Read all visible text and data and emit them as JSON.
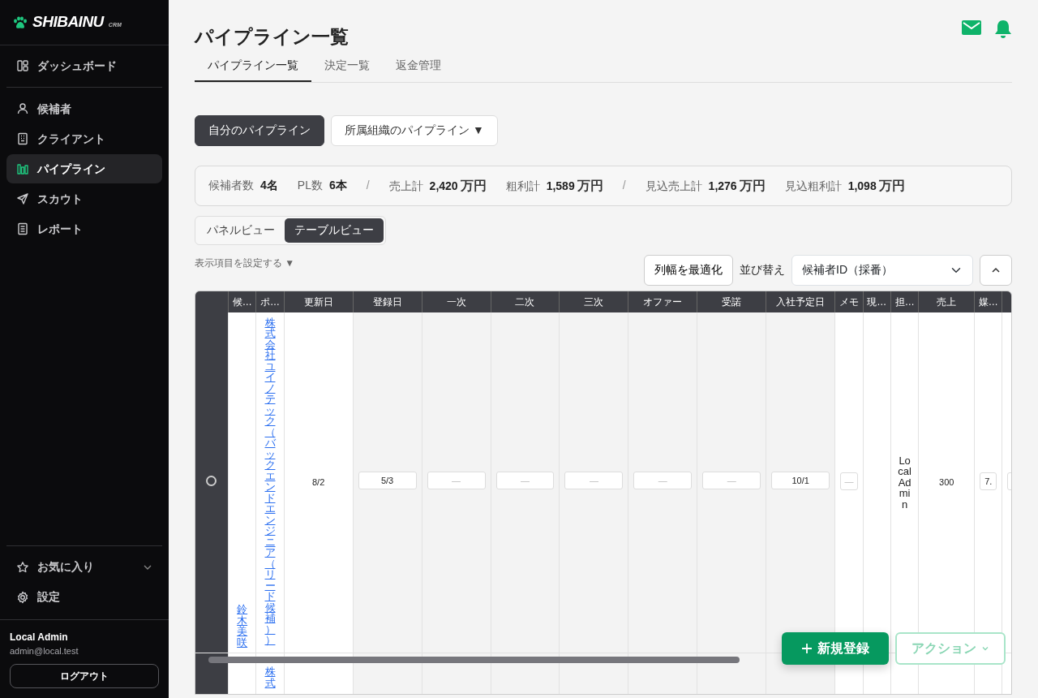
{
  "brand": {
    "name": "SHIBAINU",
    "sub": "CRM"
  },
  "nav_groups": [
    [
      {
        "label": "ダッシュボード",
        "selected": false
      }
    ],
    [
      {
        "label": "候補者",
        "selected": false
      },
      {
        "label": "クライアント",
        "selected": false
      },
      {
        "label": "パイプライン",
        "selected": true
      },
      {
        "label": "スカウト",
        "selected": false
      },
      {
        "label": "レポート",
        "selected": false
      }
    ]
  ],
  "footer_nav": [
    {
      "label": "お気に入り",
      "expanded": false
    },
    {
      "label": "設定"
    }
  ],
  "user": {
    "name": "Local Admin",
    "email": "admin@local.test",
    "logout": "ログアウト"
  },
  "page": {
    "title": "パイプライン一覧"
  },
  "tabs": [
    {
      "label": "パイプライン一覧",
      "selected": true
    },
    {
      "label": "決定一覧",
      "selected": false
    },
    {
      "label": "返金管理",
      "selected": false
    }
  ],
  "scope_buttons": [
    {
      "label": "自分のパイプライン",
      "selected": true
    },
    {
      "label": "所属組織のパイプライン ▼",
      "selected": false
    }
  ],
  "summary": [
    {
      "kind": "count",
      "label": "候補者数",
      "value": "4名"
    },
    {
      "kind": "count",
      "label": "PL数",
      "value": "6本"
    },
    {
      "kind": "divider",
      "value": "/"
    },
    {
      "kind": "money",
      "label": "売上計",
      "value": "2,420",
      "unit": "万円"
    },
    {
      "kind": "money",
      "label": "粗利計",
      "value": "1,589",
      "unit": "万円"
    },
    {
      "kind": "divider",
      "value": "/"
    },
    {
      "kind": "money",
      "label": "見込売上計",
      "value": "1,276",
      "unit": "万円"
    },
    {
      "kind": "money",
      "label": "見込粗利計",
      "value": "1,098",
      "unit": "万円"
    }
  ],
  "views": [
    {
      "label": "パネルビュー",
      "selected": false
    },
    {
      "label": "テーブルビュー",
      "selected": true
    }
  ],
  "column_settings": "表示項目を設定する ▼",
  "fit_button": "列幅を最適化",
  "sort": {
    "label": "並び替え",
    "value": "候補者ID（採番）"
  },
  "table": {
    "columns": [
      {
        "kind": "select",
        "shaded": false
      },
      {
        "label": "候…",
        "kind": "narrow",
        "shaded": false
      },
      {
        "label": "ポ…",
        "kind": "narrow",
        "shaded": false
      },
      {
        "label": "更新日",
        "kind": "wide",
        "shaded": false
      },
      {
        "label": "登録日",
        "kind": "wide",
        "shaded": true
      },
      {
        "label": "一次",
        "kind": "wide",
        "shaded": true
      },
      {
        "label": "二次",
        "kind": "wide",
        "shaded": true
      },
      {
        "label": "三次",
        "kind": "wide",
        "shaded": true
      },
      {
        "label": "オファー",
        "kind": "wide",
        "shaded": true
      },
      {
        "label": "受諾",
        "kind": "wide",
        "shaded": true
      },
      {
        "label": "入社予定日",
        "kind": "wide",
        "shaded": true
      },
      {
        "label": "メモ",
        "kind": "narrow",
        "shaded": false
      },
      {
        "label": "現…",
        "kind": "narrow",
        "shaded": false
      },
      {
        "label": "担…",
        "kind": "narrow",
        "shaded": false
      },
      {
        "label": "売上",
        "kind": "medium",
        "shaded": false
      },
      {
        "label": "媒…",
        "kind": "narrow",
        "shaded": false
      },
      {
        "kind": "narrow",
        "shaded": false
      }
    ],
    "rows": [
      {
        "cells": [
          {
            "kind": "select",
            "selected": false
          },
          {
            "kind": "name",
            "value": "鈴木美咲"
          },
          {
            "kind": "link",
            "value": "株式会社ユイノテック（バックエンドエンジニア（リード候補））"
          },
          {
            "kind": "text",
            "value": "8/2"
          },
          {
            "kind": "box",
            "value": "5/3"
          },
          {
            "kind": "box",
            "placeholder": "—"
          },
          {
            "kind": "box",
            "placeholder": "—"
          },
          {
            "kind": "box",
            "placeholder": "—"
          },
          {
            "kind": "box",
            "placeholder": "—"
          },
          {
            "kind": "box",
            "placeholder": "—"
          },
          {
            "kind": "box",
            "value": "10/1"
          },
          {
            "kind": "box",
            "placeholder": "—"
          },
          {
            "kind": "empty"
          },
          {
            "kind": "text",
            "value": "Local Admin"
          },
          {
            "kind": "text",
            "value": "300"
          },
          {
            "kind": "box",
            "value": "7."
          },
          {
            "kind": "box"
          }
        ]
      },
      {
        "cells": [
          {
            "kind": "select"
          },
          {
            "kind": "empty"
          },
          {
            "kind": "link",
            "value": "株式"
          },
          {
            "kind": "empty"
          },
          {
            "kind": "empty"
          },
          {
            "kind": "empty"
          },
          {
            "kind": "empty"
          },
          {
            "kind": "empty"
          },
          {
            "kind": "empty"
          },
          {
            "kind": "empty"
          },
          {
            "kind": "empty"
          },
          {
            "kind": "empty"
          },
          {
            "kind": "empty"
          },
          {
            "kind": "empty"
          },
          {
            "kind": "empty"
          },
          {
            "kind": "empty"
          },
          {
            "kind": "empty"
          }
        ]
      }
    ]
  },
  "fab": {
    "create": "新規登録",
    "action": "アクション"
  }
}
